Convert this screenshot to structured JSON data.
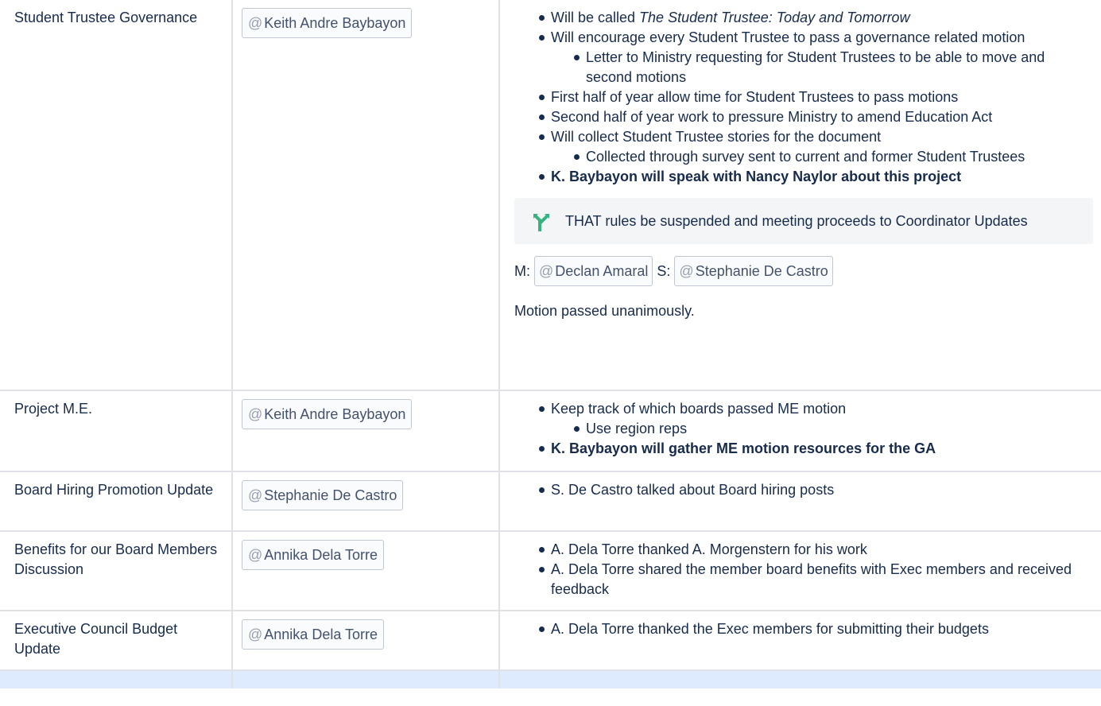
{
  "rows": [
    {
      "topic": "Student Trustee Governance",
      "owner": "Keith Andre Baybayon",
      "bullets": {
        "b0_pre": "Will be called ",
        "b0_em": "The Student Trustee: Today and Tomorrow",
        "b1": "Will encourage every Student Trustee to pass a governance related motion",
        "b1_sub0": "Letter to Ministry requesting for Student Trustees to be able to move and second motions",
        "b2": "First half of year  allow time for Student Trustees to pass motions",
        "b3": "Second half of year  work to pressure Ministry to amend Education Act",
        "b4": "Will collect Student Trustee stories for the document",
        "b4_sub0": "Collected through survey sent to current and former Student Trustees",
        "b5": "K. Baybayon will speak with Nancy Naylor about this project"
      },
      "motion_text": "THAT rules be suspended and meeting proceeds to Coordinator Updates",
      "mover_label": "M:",
      "mover": "Declan Amaral",
      "seconder_label": "S:",
      "seconder": "Stephanie De Castro",
      "result": "Motion passed unanimously."
    },
    {
      "topic": "Project M.E.",
      "owner": "Keith Andre Baybayon",
      "bullets": {
        "b0": "Keep track of which boards passed ME motion",
        "b0_sub0": "Use region reps",
        "b1": "K. Baybayon will gather ME motion resources for the GA"
      }
    },
    {
      "topic": "Board Hiring Promotion Update",
      "owner": "Stephanie De Castro",
      "bullets": {
        "b0": "S. De Castro talked about Board hiring posts"
      }
    },
    {
      "topic": "Benefits for our Board Members Discussion",
      "owner": "Annika Dela Torre",
      "bullets": {
        "b0": "A. Dela Torre thanked A. Morgenstern for his work",
        "b1": "A. Dela Torre shared the member board benefits with Exec members and received feedback"
      }
    },
    {
      "topic": "Executive Council Budget Update",
      "owner": "Annika Dela Torre",
      "bullets": {
        "b0": "A. Dela Torre thanked the Exec members for submitting their budgets"
      }
    }
  ],
  "mention_prefix": "@",
  "colors": {
    "accent_icon": "#36b37e",
    "mention_text": "#42526e",
    "panel_bg": "#f4f5f7",
    "highlight_row": "#deebff"
  },
  "icons": {
    "motion_icon": "branch-icon"
  }
}
